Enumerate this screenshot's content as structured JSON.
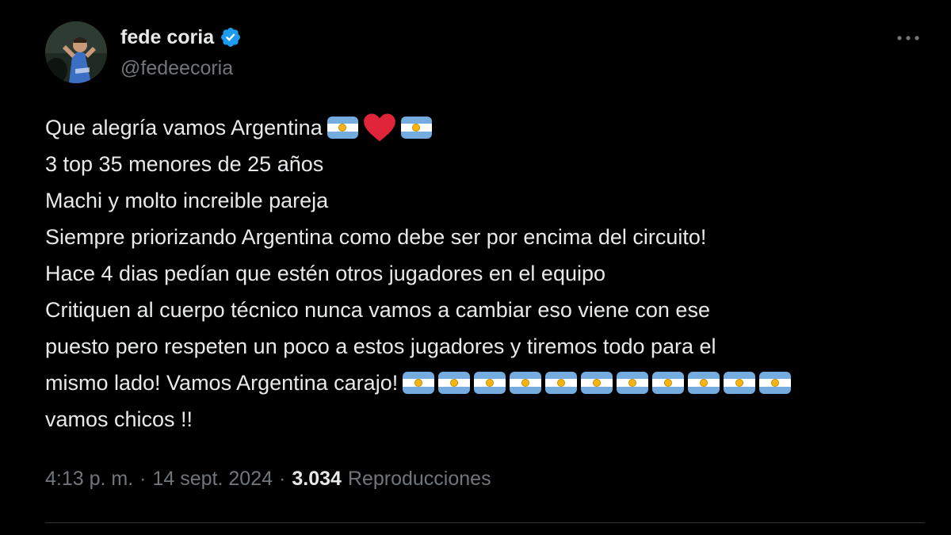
{
  "author": {
    "display_name": "fede coria",
    "handle": "@fedeecoria",
    "verified": true,
    "verified_color": "#1d9bf0"
  },
  "more_icon": "more-horizontal-icon",
  "tweet": {
    "lines": [
      "Que alegría vamos Argentina",
      "3 top 35 menores de 25 años",
      "Machi y molto increible pareja",
      "Siempre priorizando Argentina como debe ser por encima del circuito!",
      "Hace 4 dias pedían que estén otros jugadores en el equipo",
      "Critiquen al cuerpo técnico nunca vamos a cambiar eso viene con ese",
      "puesto pero respeten un poco a estos jugadores y tiremos todo para el",
      "mismo lado! Vamos Argentina carajo!",
      "vamos chicos !!"
    ],
    "line1_emojis": [
      "argentina-flag",
      "red-heart",
      "argentina-flag"
    ],
    "line8_flag_count": 11
  },
  "meta": {
    "time": "4:13 p. m.",
    "sep1": "·",
    "date": "14 sept. 2024",
    "sep2": "·",
    "views_count": "3.034",
    "views_label": "Reproducciones"
  },
  "colors": {
    "background": "#000000",
    "text": "#e7e9ea",
    "secondary": "#71767b",
    "divider": "#2f3336",
    "flag_blue": "#74acdf",
    "heart": "#e0243a"
  }
}
